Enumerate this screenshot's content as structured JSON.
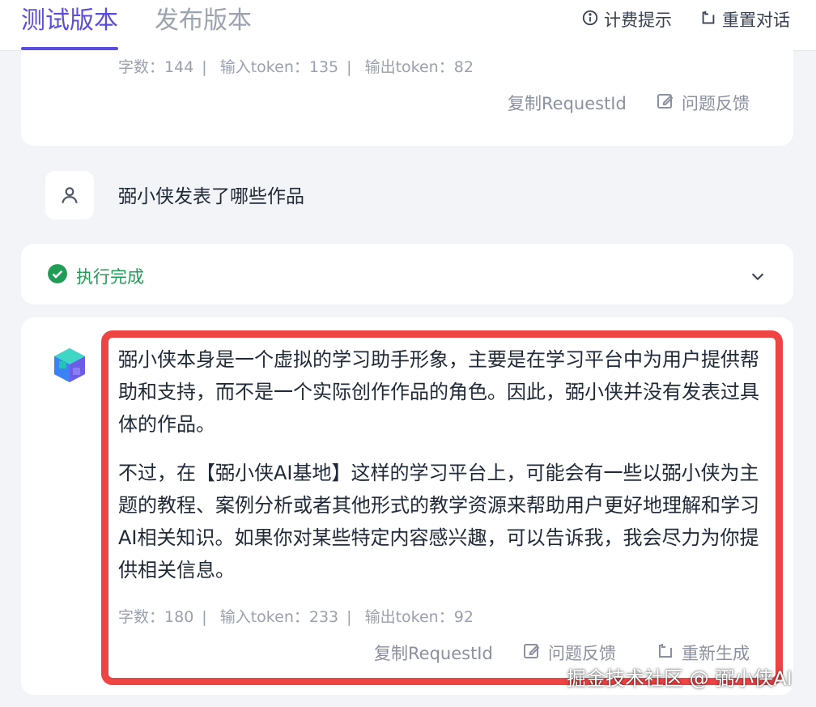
{
  "header": {
    "tabs": [
      {
        "label": "测试版本",
        "active": true
      },
      {
        "label": "发布版本",
        "active": false
      }
    ],
    "billing_label": "计费提示",
    "reset_label": "重置对话"
  },
  "prev_message": {
    "stats": {
      "chars_label": "字数：",
      "chars": "144",
      "input_label": "输入token：",
      "input": "135",
      "output_label": "输出token：",
      "output": "82"
    },
    "copy_label": "复制RequestId",
    "feedback_label": "问题反馈"
  },
  "user_message": {
    "text": "弼小侠发表了哪些作品"
  },
  "status": {
    "label": "执行完成",
    "color": "#1f9d55"
  },
  "bot_message": {
    "paragraphs": [
      "弼小侠本身是一个虚拟的学习助手形象，主要是在学习平台中为用户提供帮助和支持，而不是一个实际创作作品的角色。因此，弼小侠并没有发表过具体的作品。",
      "不过，在【弼小侠AI基地】这样的学习平台上，可能会有一些以弼小侠为主题的教程、案例分析或者其他形式的教学资源来帮助用户更好地理解和学习AI相关知识。如果你对某些特定内容感兴趣，可以告诉我，我会尽力为你提供相关信息。"
    ],
    "stats": {
      "chars_label": "字数：",
      "chars": "180",
      "input_label": "输入token：",
      "input": "233",
      "output_label": "输出token：",
      "output": "92"
    },
    "copy_label": "复制RequestId",
    "feedback_label": "问题反馈",
    "regenerate_label": "重新生成"
  },
  "watermark": "掘金技术社区 @ 弼小侠AI",
  "colors": {
    "accent": "#5b4ce0",
    "highlight": "#ef4444",
    "muted": "#9aa0ad"
  }
}
